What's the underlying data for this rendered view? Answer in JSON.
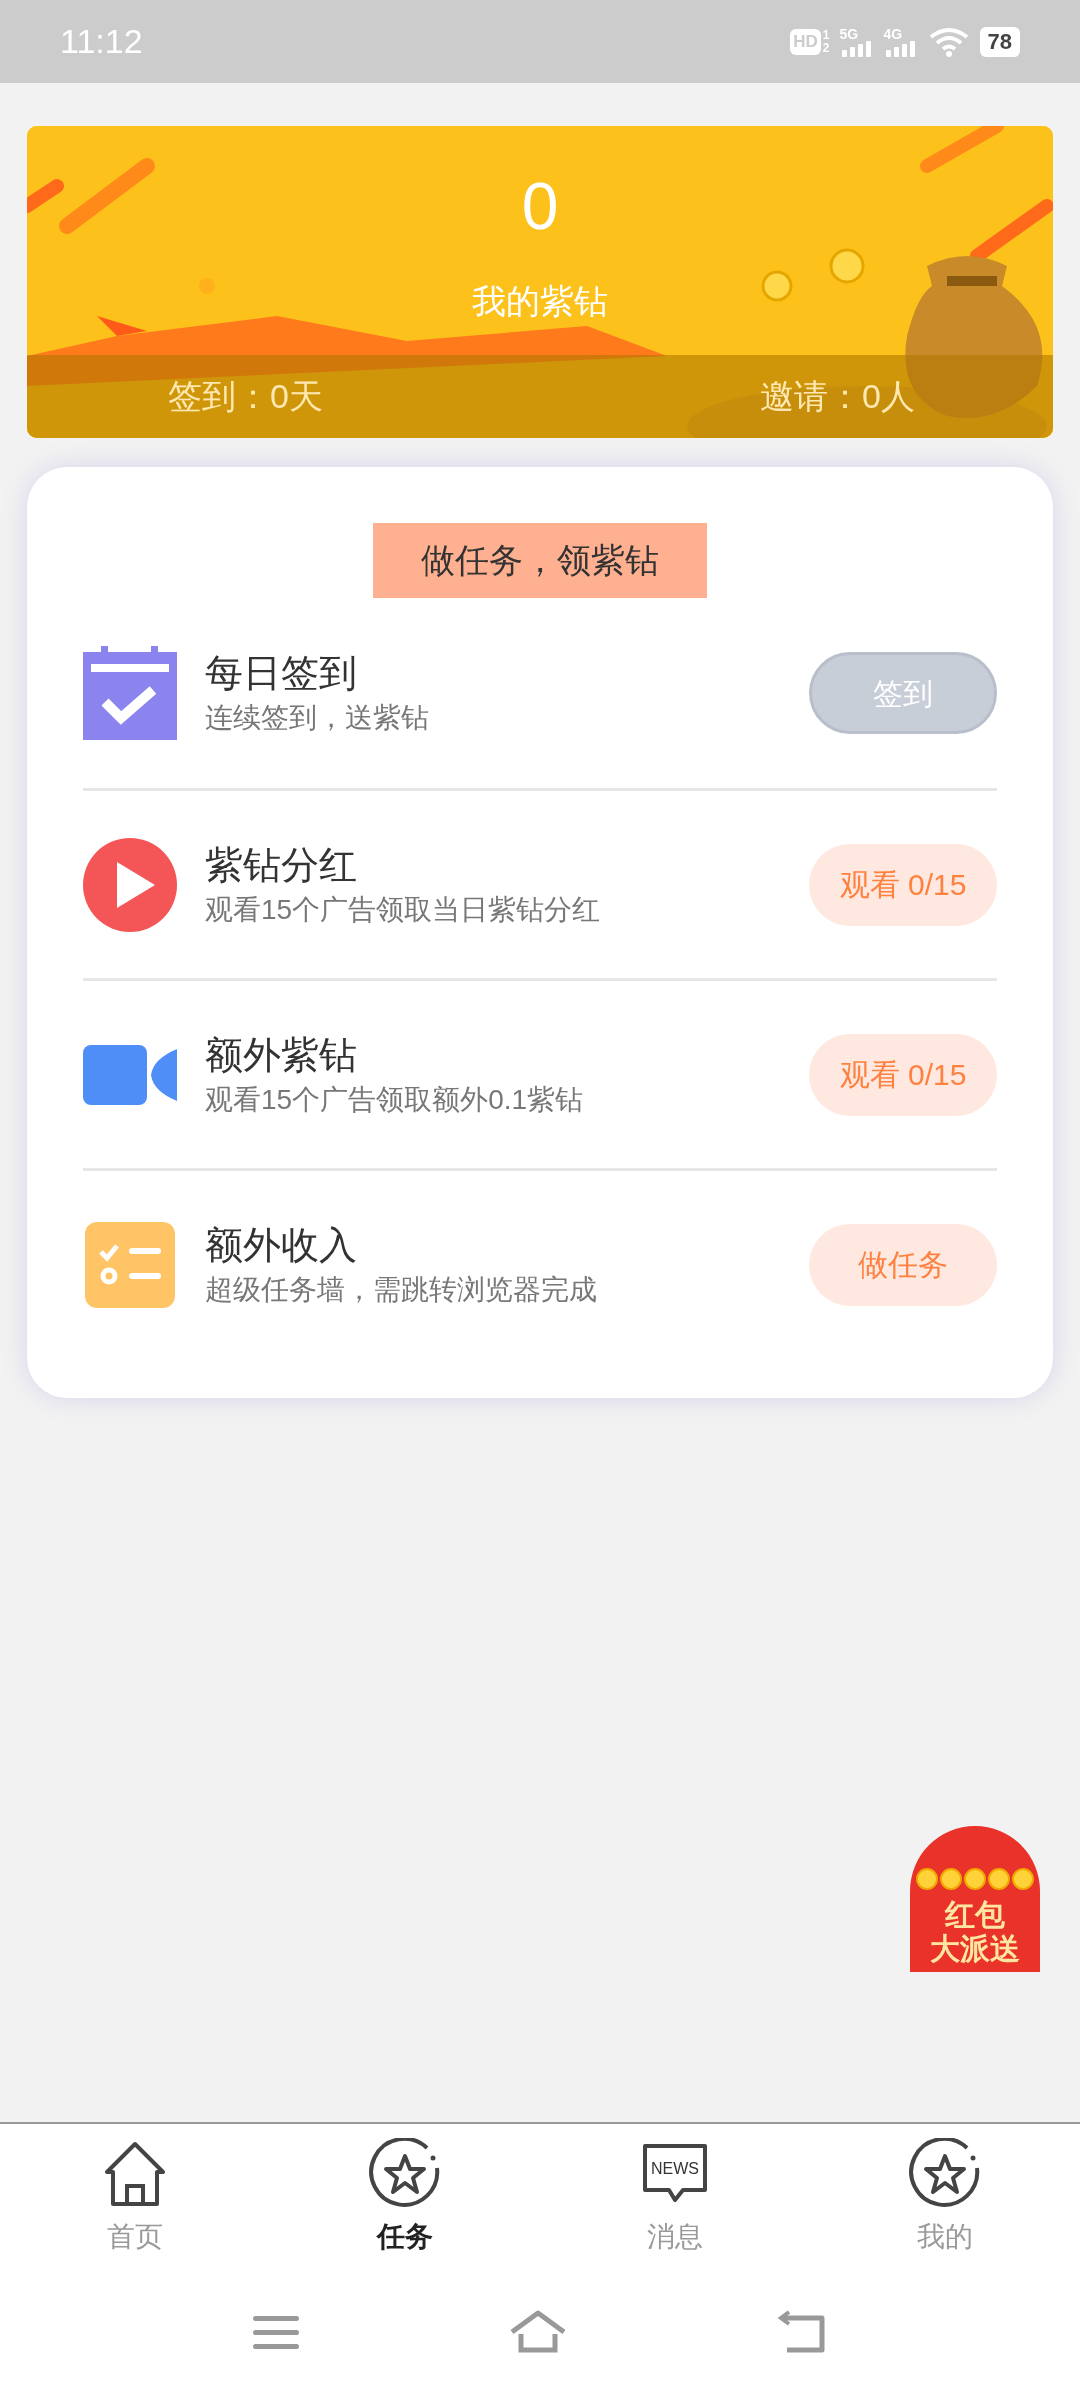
{
  "status_bar": {
    "time": "11:12",
    "hd": "HD",
    "hd_sims": [
      "1",
      "2"
    ],
    "networks": [
      "5G",
      "4G"
    ],
    "battery": "78"
  },
  "banner": {
    "value": "0",
    "label": "我的紫钻",
    "checkin": "签到：0天",
    "invite": "邀请：0人"
  },
  "tasks": {
    "heading": "做任务，领紫钻",
    "items": [
      {
        "kind": "calendar",
        "title": "每日签到",
        "subtitle": "连续签到，送紫钻",
        "button": "签到",
        "disabled": true
      },
      {
        "kind": "play",
        "title": "紫钻分红",
        "subtitle": "观看15个广告领取当日紫钻分红",
        "button": "观看 0/15",
        "disabled": false
      },
      {
        "kind": "video",
        "title": "额外紫钻",
        "subtitle": "观看15个广告领取额外0.1紫钻",
        "button": "观看 0/15",
        "disabled": false
      },
      {
        "kind": "list",
        "title": "额外收入",
        "subtitle": "超级任务墙，需跳转浏览器完成",
        "button": "做任务",
        "disabled": false
      }
    ]
  },
  "red_packet": {
    "lines": [
      "红包",
      "大派送"
    ]
  },
  "tabs": [
    {
      "kind": "home",
      "label": "首页",
      "selected": false
    },
    {
      "kind": "star",
      "label": "任务",
      "selected": true
    },
    {
      "kind": "news",
      "icon_text": "NEWS",
      "label": "消息",
      "selected": false
    },
    {
      "kind": "star",
      "label": "我的",
      "selected": false
    }
  ]
}
